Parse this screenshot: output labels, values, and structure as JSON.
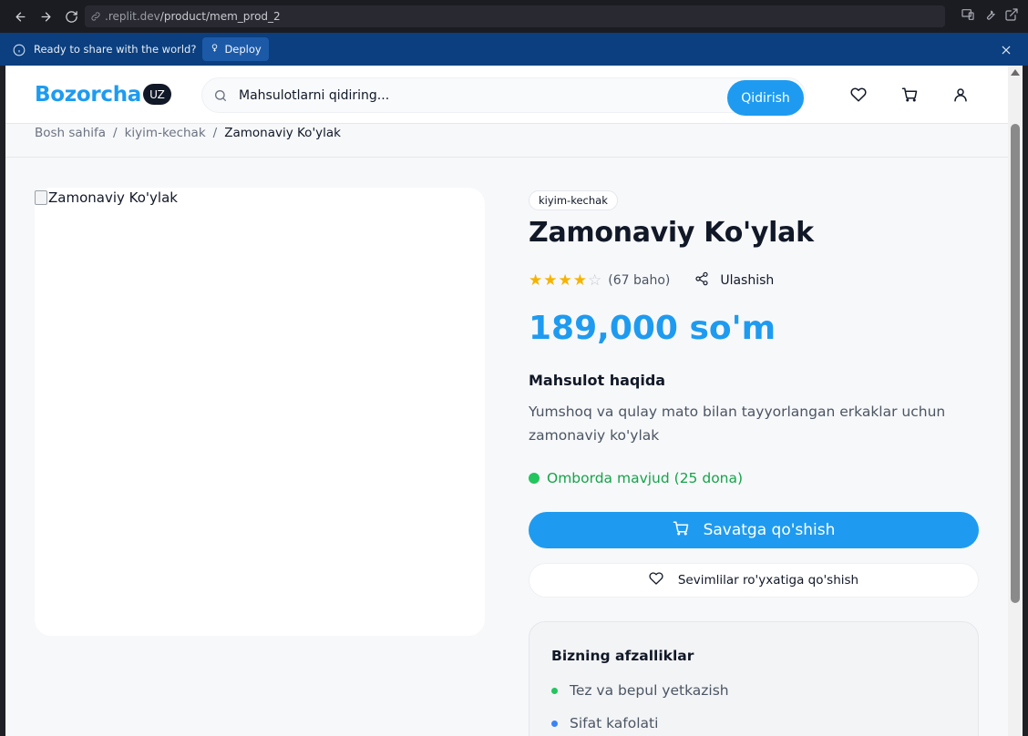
{
  "browser": {
    "url_prefix": ".replit.dev",
    "url_path": "/product/mem_prod_2"
  },
  "banner": {
    "text": "Ready to share with the world?",
    "deploy_label": "Deploy"
  },
  "header": {
    "logo": "Bozorcha",
    "lang": "UZ",
    "search_placeholder": "Mahsulotlarni qidiring...",
    "search_button": "Qidirish"
  },
  "breadcrumb": {
    "home": "Bosh sahifa",
    "separator": "/",
    "category": "kiyim-kechak",
    "current": "Zamonaviy Ko'ylak"
  },
  "product": {
    "image_alt": "Zamonaviy Ko'ylak",
    "category": "kiyim-kechak",
    "title": "Zamonaviy Ko'ylak",
    "rating": 4,
    "rating_max": 5,
    "rating_count": "(67 baho)",
    "share_label": "Ulashish",
    "price": "189,000 so'm",
    "about_heading": "Mahsulot haqida",
    "description": "Yumshoq va qulay mato bilan tayyorlangan erkaklar uchun zamonaviy ko'ylak",
    "stock": "Omborda mavjud (25 dona)",
    "add_to_cart": "Savatga qo'shish",
    "add_to_favorites": "Sevimlilar ro'yxatiga qo'shish"
  },
  "benefits": {
    "heading": "Bizning afzalliklar",
    "items": [
      {
        "text": "Tez va bepul yetkazish",
        "color": "#22c55e"
      },
      {
        "text": "Sifat kafolati",
        "color": "#3b82f6"
      }
    ]
  },
  "colors": {
    "accent": "#1e9bf0",
    "stock_green": "#16a34a",
    "star": "#f5b301"
  }
}
